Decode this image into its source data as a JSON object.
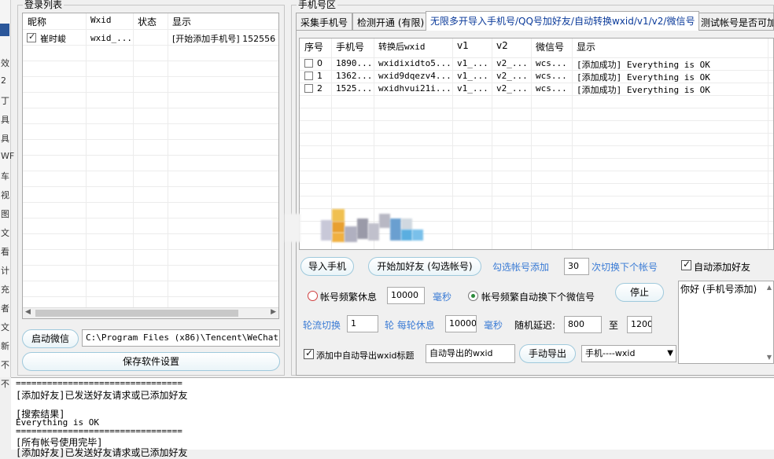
{
  "left_strip_chars": [
    "效",
    "2",
    "丁",
    "具",
    "具",
    "WF",
    "车",
    "视",
    "图",
    "文",
    "看",
    "计",
    "充",
    "者",
    "文",
    "新",
    "不",
    "不"
  ],
  "login_list": {
    "title": "登录列表",
    "columns": [
      "昵称",
      "Wxid",
      "状态",
      "显示"
    ],
    "rows": [
      {
        "checked": true,
        "nickname": "崔时峻",
        "wxid": "wxid_...",
        "status": "",
        "display": "[开始添加手机号] 152556"
      }
    ],
    "start_wechat_button": "启动微信",
    "wechat_path": "C:\\Program Files (x86)\\Tencent\\WeChat",
    "save_settings_button": "保存软件设置"
  },
  "phone_area": {
    "title": "手机号区",
    "tabs": [
      "采集手机号",
      "检测开通 (有限)",
      "无限多开导入手机号/QQ号加好友/自动转换wxid/v1/v2/微信号",
      "测试帐号是否可加"
    ],
    "columns": [
      "序号",
      "手机号",
      "转换后wxid",
      "v1",
      "v2",
      "微信号",
      "显示"
    ],
    "rows": [
      {
        "index": "0",
        "phone": "1890...",
        "wxid": "wxidixidto5...",
        "v1": "v1_...",
        "v2": "v2_...",
        "wechat_id": "wcs...",
        "display": "[添加成功] Everything is OK"
      },
      {
        "index": "1",
        "phone": "1362...",
        "wxid": "wxid9dqezv4...",
        "v1": "v1_...",
        "v2": "v2_...",
        "wechat_id": "wcs...",
        "display": "[添加成功] Everything is OK"
      },
      {
        "index": "2",
        "phone": "1525...",
        "wxid": "wxidhvui21i...",
        "v1": "v1_...",
        "v2": "v2_...",
        "wechat_id": "wcs...",
        "display": "[添加成功] Everything is OK"
      }
    ],
    "import_button": "导入手机",
    "start_add_button": "开始加好友 (勾选帐号)",
    "check_account_add_label": "勾选帐号添加",
    "switch_count": "30",
    "switch_label": "次切换下个帐号",
    "auto_add_label": "自动添加好友",
    "auto_add_checked": true,
    "rest_radio_label": "帐号频繁休息",
    "rest_ms": "10000",
    "ms_label": "毫秒",
    "auto_switch_radio_label": "帐号频繁自动换下个微信号",
    "auto_switch_selected": true,
    "stop_button": "停止",
    "rotate_label": "轮流切换",
    "rotate_value": "1",
    "round_rest_label": "轮 每轮休息",
    "round_rest_ms": "10000",
    "ms_label2": "毫秒",
    "random_delay_label": "随机延迟:",
    "delay_min": "800",
    "to_label": "至",
    "delay_max": "1200",
    "greeting_text": "你好 (手机号添加)",
    "auto_export_label": "添加中自动导出wxid标题",
    "auto_export_checked": true,
    "auto_export_value": "自动导出的wxid",
    "manual_export_button": "手动导出",
    "export_format": "手机----wxid"
  },
  "log": {
    "lines": [
      "================================",
      "[添加好友]已发送好友请求或已添加好友",
      "[搜索结果]",
      "Everything is OK",
      "================================",
      "[所有帐号使用完毕]",
      "[添加好友]已发送好友请求或已添加好友"
    ]
  }
}
